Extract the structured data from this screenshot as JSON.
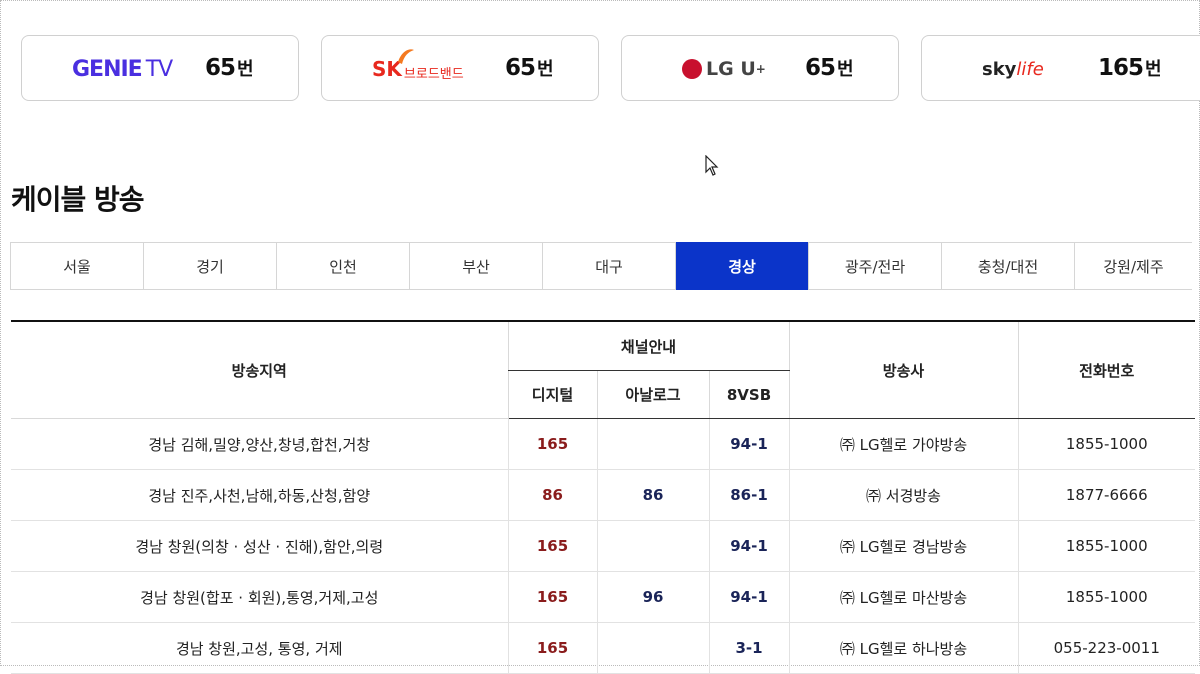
{
  "providers": [
    {
      "logo_main": "GENIE",
      "logo_sub": "TV",
      "channel": "65",
      "unit": "번"
    },
    {
      "logo_main": "SK",
      "logo_sub": "브로드밴드",
      "channel": "65",
      "unit": "번"
    },
    {
      "logo_main": "LG U",
      "logo_sub": "+",
      "channel": "65",
      "unit": "번"
    },
    {
      "logo_main": "sky",
      "logo_sub": "life",
      "channel": "165",
      "unit": "번"
    }
  ],
  "section_title": "케이블 방송",
  "tabs": [
    "서울",
    "경기",
    "인천",
    "부산",
    "대구",
    "경상",
    "광주/전라",
    "충청/대전",
    "강원/제주"
  ],
  "active_tab": "경상",
  "table": {
    "headers": {
      "region": "방송지역",
      "channel_group": "채널안내",
      "digital": "디지털",
      "analog": "아날로그",
      "vsb": "8VSB",
      "broadcaster": "방송사",
      "phone": "전화번호"
    },
    "rows": [
      {
        "region": "경남 김해,밀양,양산,창녕,합천,거창",
        "digital": "165",
        "analog": "",
        "vsb": "94-1",
        "broadcaster": "㈜ LG헬로 가야방송",
        "phone": "1855-1000"
      },
      {
        "region": "경남 진주,사천,남해,하동,산청,함양",
        "digital": "86",
        "analog": "86",
        "vsb": "86-1",
        "broadcaster": "㈜ 서경방송",
        "phone": "1877-6666"
      },
      {
        "region": "경남 창원(의창 · 성산 · 진해),함안,의령",
        "digital": "165",
        "analog": "",
        "vsb": "94-1",
        "broadcaster": "㈜ LG헬로 경남방송",
        "phone": "1855-1000"
      },
      {
        "region": "경남 창원(합포 · 회원),통영,거제,고성",
        "digital": "165",
        "analog": "96",
        "vsb": "94-1",
        "broadcaster": "㈜ LG헬로 마산방송",
        "phone": "1855-1000"
      },
      {
        "region": "경남 창원,고성, 통영, 거제",
        "digital": "165",
        "analog": "",
        "vsb": "3-1",
        "broadcaster": "㈜ LG헬로 하나방송",
        "phone": "055-223-0011"
      }
    ]
  },
  "colors": {
    "active_tab_bg": "#0b34c9",
    "digital_text": "#8a1c1c",
    "analog_text": "#1a2458",
    "genie_brand": "#4a2fe0",
    "sk_brand": "#e8281e",
    "lg_brand": "#c8102e"
  },
  "icons": [
    "mouse-cursor-icon",
    "lg-logo-circle-icon",
    "sk-logo-wing-icon"
  ]
}
